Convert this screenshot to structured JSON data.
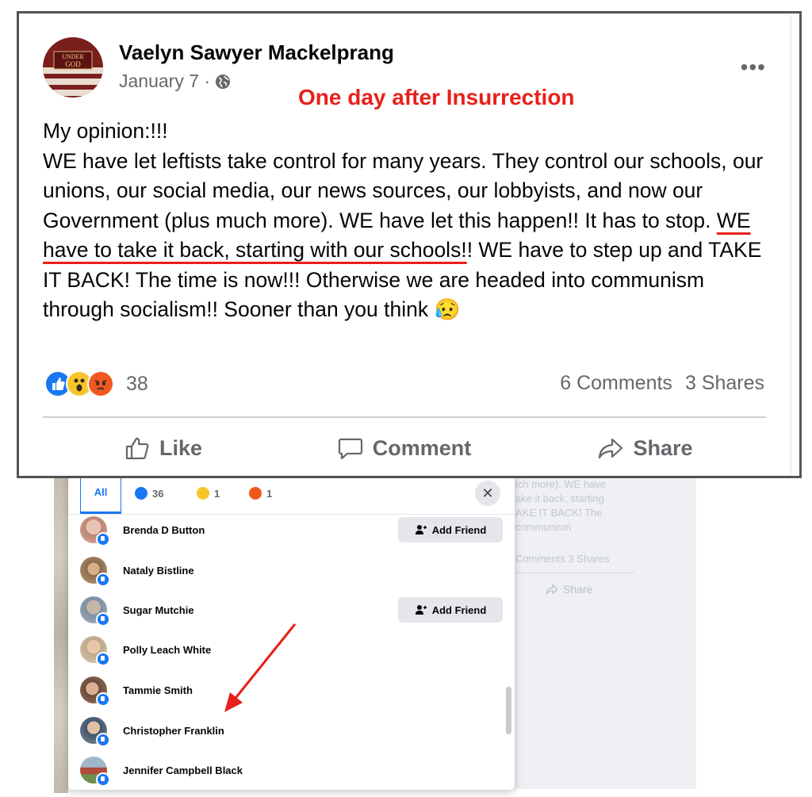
{
  "post": {
    "author": "Vaelyn Sawyer Mackelprang",
    "date": "January 7 ·",
    "annotation": "One day after Insurrection",
    "avatar_text": "UNDER GOD",
    "text_intro": "My opinion:!!!",
    "text_before_underline": "WE have let leftists take control for many years. They control our schools, our unions, our social media, our news sources, our lobbyists, and now our Government (plus much more). WE have let this happen!! It has to stop. ",
    "text_underlined": "WE have to take it back, starting with our schools!",
    "text_after_underline": "! WE have to step up and TAKE IT BACK! The time is now!!! Otherwise we are headed into communism through socialism!!   Sooner than you think 😥",
    "reaction_count": "38",
    "comments": "6 Comments",
    "shares": "3 Shares",
    "actions": {
      "like": "Like",
      "comment": "Comment",
      "share": "Share"
    }
  },
  "dialog": {
    "tabs": {
      "all": "All",
      "like": "36",
      "wow": "1",
      "angry": "1"
    },
    "add_friend_label": "Add Friend",
    "people": [
      {
        "name": "Brenda D Button",
        "add_friend": true
      },
      {
        "name": "Nataly Bistline",
        "add_friend": false
      },
      {
        "name": "Sugar Mutchie",
        "add_friend": true
      },
      {
        "name": "Polly Leach White",
        "add_friend": false
      },
      {
        "name": "Tammie Smith",
        "add_friend": false
      },
      {
        "name": "Christopher Franklin",
        "add_friend": false
      },
      {
        "name": "Jennifer Campbell Black",
        "add_friend": false
      }
    ]
  },
  "background": {
    "ghost_lines": [
      "ich more). WE have",
      "ake it back, starting",
      "AKE IT BACK! The",
      "communism"
    ],
    "ghost_counts": "Comments  3 Shares",
    "ghost_share": "Share"
  },
  "colors": {
    "annotation_red": "#e8201a",
    "like_blue": "#1877f2",
    "wow_yellow": "#f7c52b",
    "angry_orange": "#f0581f"
  }
}
